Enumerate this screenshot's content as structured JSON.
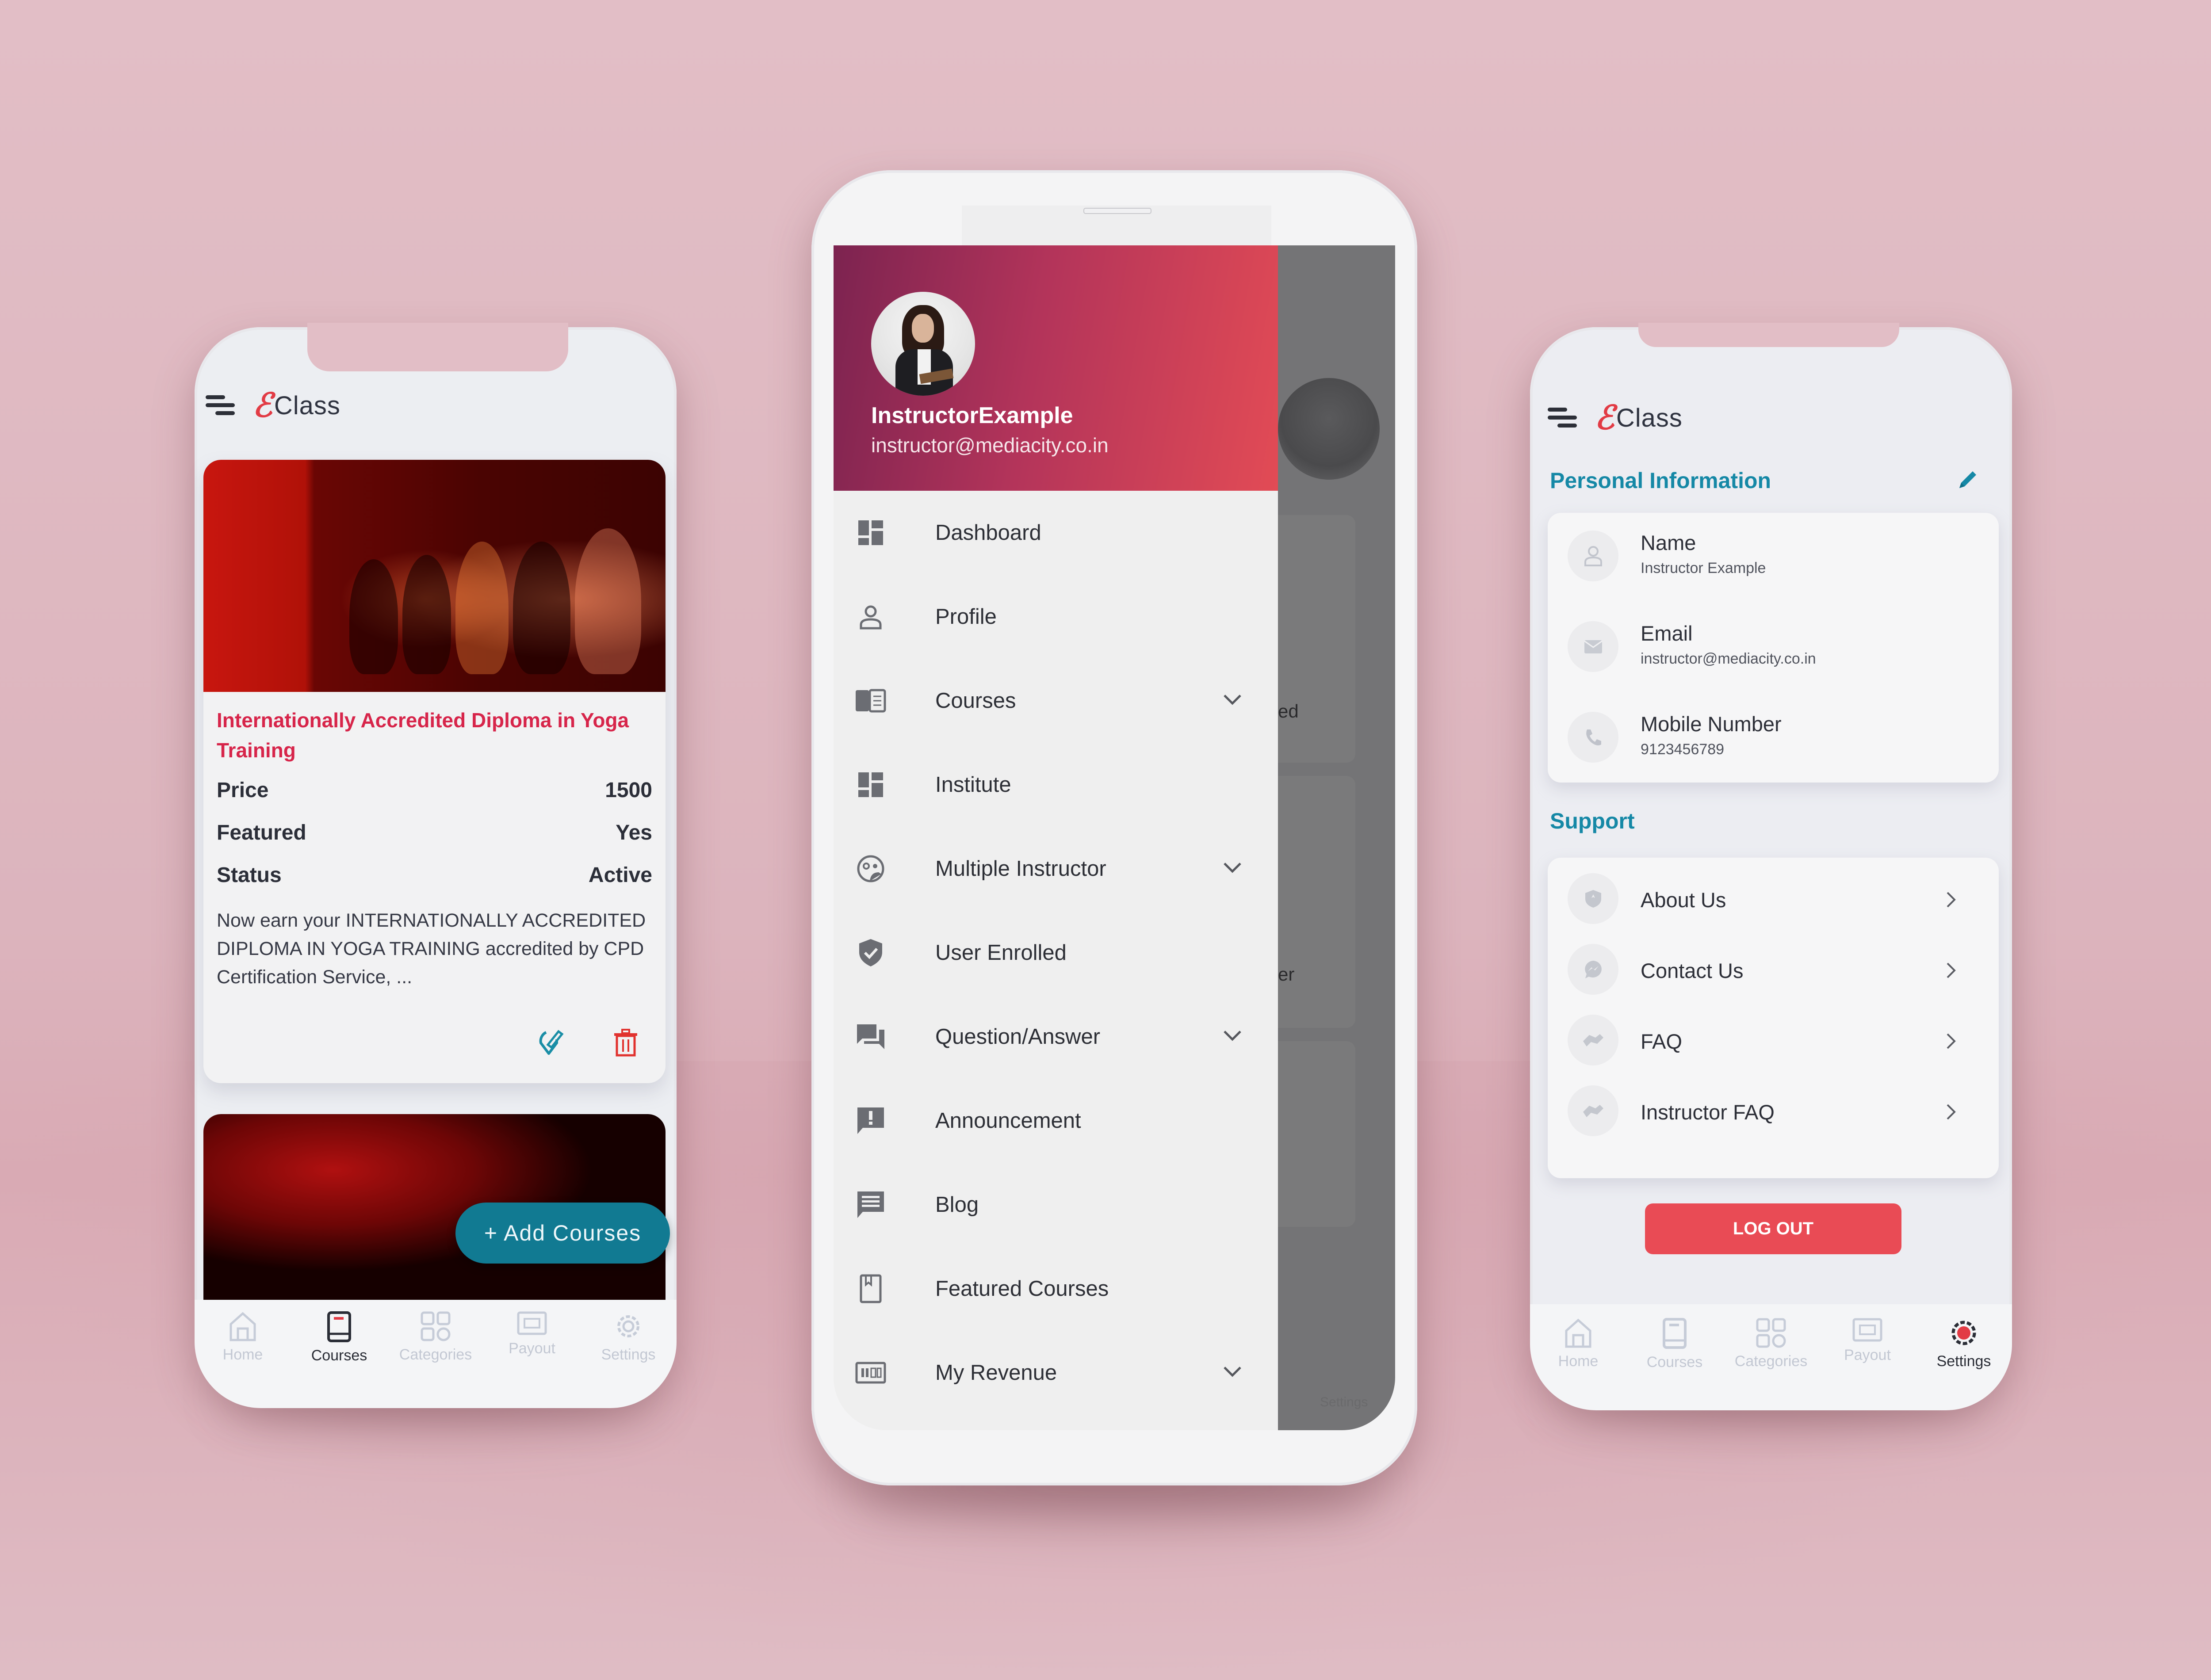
{
  "app": {
    "brand_mark": "ℰ",
    "brand_name": "Class"
  },
  "colors": {
    "accent_teal": "#1588a6",
    "brand_red": "#e23b45",
    "course_title": "#d7254a",
    "logout_red": "#e94b55",
    "add_button": "#117a92"
  },
  "courses_screen": {
    "course": {
      "title": "Internationally Accredited Diploma in Yoga Training",
      "fields": [
        {
          "label": "Price",
          "value": "1500"
        },
        {
          "label": "Featured",
          "value": "Yes"
        },
        {
          "label": "Status",
          "value": "Active"
        }
      ],
      "description": "Now earn your INTERNATIONALLY ACCREDITED DIPLOMA IN YOGA TRAINING accredited by CPD Certification Service, ...",
      "actions": [
        {
          "icon": "edit-icon"
        },
        {
          "icon": "trash-icon"
        }
      ]
    },
    "add_button_label": "+ Add Courses",
    "bottom_nav": [
      {
        "label": "Home",
        "icon": "home-icon",
        "active": false
      },
      {
        "label": "Courses",
        "icon": "book-icon",
        "active": true
      },
      {
        "label": "Categories",
        "icon": "grid-icon",
        "active": false
      },
      {
        "label": "Payout",
        "icon": "payout-icon",
        "active": false
      },
      {
        "label": "Settings",
        "icon": "gear-icon",
        "active": false
      }
    ]
  },
  "drawer_screen": {
    "user": {
      "name": "InstructorExample",
      "email": "instructor@mediacity.co.in"
    },
    "menu": [
      {
        "label": "Dashboard",
        "icon": "dashboard-icon",
        "expandable": false
      },
      {
        "label": "Profile",
        "icon": "person-icon",
        "expandable": false
      },
      {
        "label": "Courses",
        "icon": "book-open-icon",
        "expandable": true
      },
      {
        "label": "Institute",
        "icon": "dashboard-icon",
        "expandable": false
      },
      {
        "label": "Multiple Instructor",
        "icon": "group-icon",
        "expandable": true
      },
      {
        "label": "User Enrolled",
        "icon": "shield-check-icon",
        "expandable": false
      },
      {
        "label": "Question/Answer",
        "icon": "chat-icon",
        "expandable": true
      },
      {
        "label": "Announcement",
        "icon": "announcement-icon",
        "expandable": false
      },
      {
        "label": "Blog",
        "icon": "message-icon",
        "expandable": false
      },
      {
        "label": "Featured Courses",
        "icon": "bookmark-icon",
        "expandable": false
      },
      {
        "label": "My Revenue",
        "icon": "revenue-icon",
        "expandable": true
      }
    ],
    "background_fragments": [
      "ed",
      "er",
      "Settings"
    ]
  },
  "settings_screen": {
    "personal_title": "Personal Information",
    "personal": [
      {
        "label": "Name",
        "value": "Instructor Example",
        "icon": "person-icon"
      },
      {
        "label": "Email",
        "value": "instructor@mediacity.co.in",
        "icon": "mail-icon"
      },
      {
        "label": "Mobile Number",
        "value": "9123456789",
        "icon": "phone-icon"
      }
    ],
    "support_title": "Support",
    "support": [
      {
        "label": "About Us",
        "icon": "shield-icon"
      },
      {
        "label": "Contact Us",
        "icon": "messenger-icon"
      },
      {
        "label": "FAQ",
        "icon": "handshake-icon"
      },
      {
        "label": "Instructor FAQ",
        "icon": "handshake-icon"
      }
    ],
    "logout_label": "LOG OUT",
    "bottom_nav": [
      {
        "label": "Home",
        "icon": "home-icon",
        "active": false
      },
      {
        "label": "Courses",
        "icon": "book-icon",
        "active": false
      },
      {
        "label": "Categories",
        "icon": "grid-icon",
        "active": false
      },
      {
        "label": "Payout",
        "icon": "payout-icon",
        "active": false
      },
      {
        "label": "Settings",
        "icon": "gear-icon",
        "active": true
      }
    ]
  }
}
